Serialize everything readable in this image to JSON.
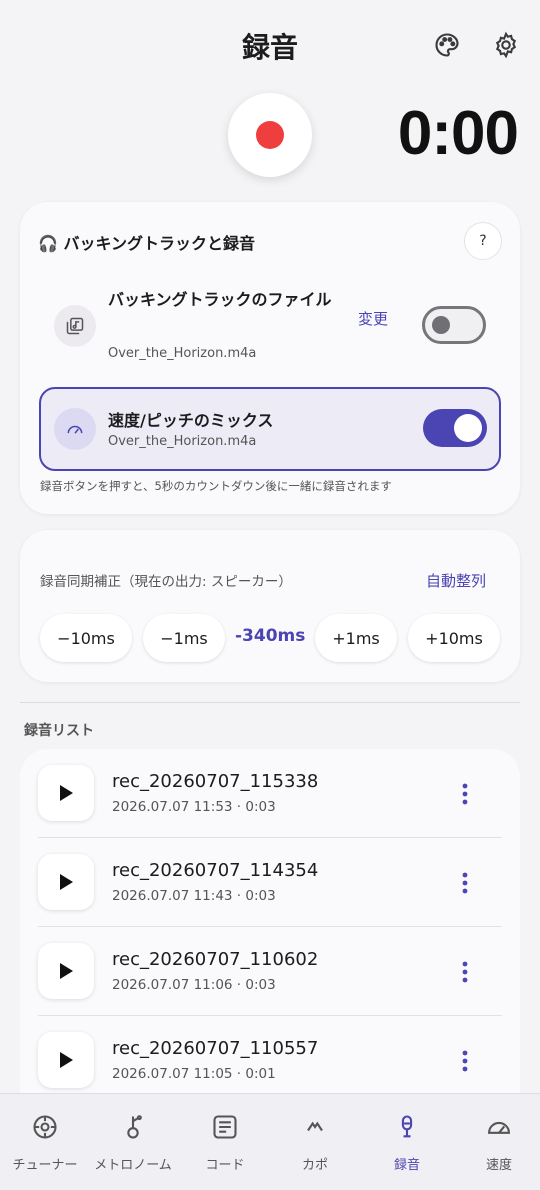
{
  "header": {
    "title": "録音"
  },
  "timer": "0:00",
  "backing": {
    "title": "🎧 バッキングトラックと録音",
    "help": "?",
    "file_title": "バッキングトラックのファイル",
    "file_name": "Over_the_Horizon.m4a",
    "change": "変更",
    "file_toggle": false,
    "mix_title": "速度/ピッチのミックス",
    "mix_file": "Over_the_Horizon.m4a",
    "mix_toggle": true,
    "hint": "録音ボタンを押すと、5秒のカウントダウン後に一緒に録音されます"
  },
  "sync": {
    "label": "録音同期補正（現在の出力: スピーカー）",
    "auto": "自動整列",
    "minus10": "−10ms",
    "minus1": "−1ms",
    "value": "-340ms",
    "plus1": "+1ms",
    "plus10": "+10ms"
  },
  "recordings": {
    "label": "録音リスト",
    "items": [
      {
        "name": "rec_20260707_115338",
        "meta": "2026.07.07 11:53 · 0:03"
      },
      {
        "name": "rec_20260707_114354",
        "meta": "2026.07.07 11:43 · 0:03"
      },
      {
        "name": "rec_20260707_110602",
        "meta": "2026.07.07 11:06 · 0:03"
      },
      {
        "name": "rec_20260707_110557",
        "meta": "2026.07.07 11:05 · 0:01"
      }
    ]
  },
  "nav": {
    "items": [
      {
        "label": "チューナー",
        "icon": "tuner-icon"
      },
      {
        "label": "メトロノーム",
        "icon": "metronome-icon"
      },
      {
        "label": "コード",
        "icon": "chord-icon"
      },
      {
        "label": "カポ",
        "icon": "capo-icon"
      },
      {
        "label": "録音",
        "icon": "microphone-icon"
      },
      {
        "label": "速度",
        "icon": "speedometer-icon"
      }
    ],
    "active": 4
  },
  "colors": {
    "accent": "#4b44b3",
    "record": "#ef3e3e",
    "background": "#f4f4f6"
  }
}
